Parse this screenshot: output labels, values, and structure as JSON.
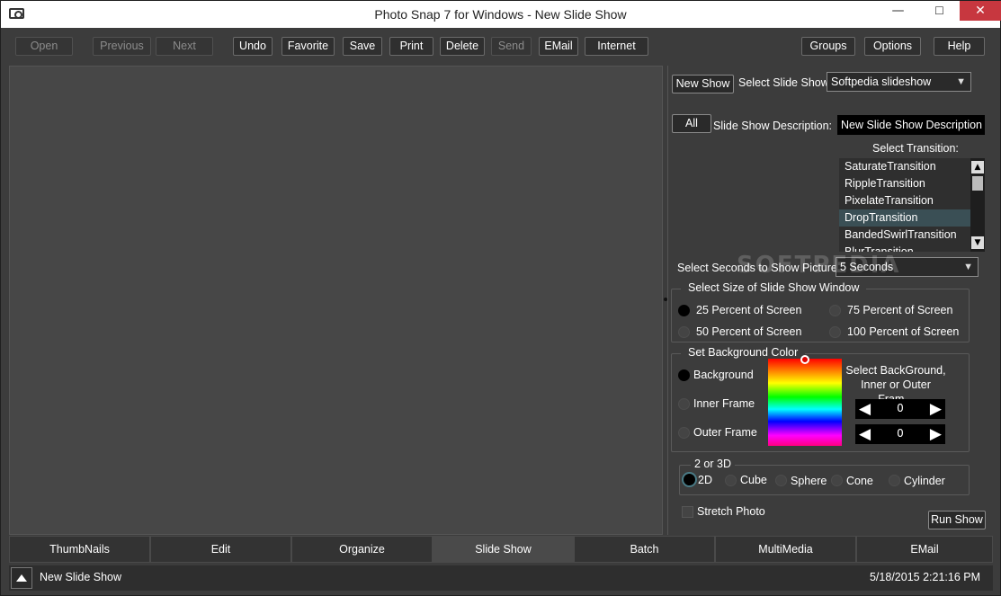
{
  "window": {
    "title": "Photo Snap 7 for Windows - New Slide Show",
    "minimize": "—",
    "maximize": "☐",
    "close": "✕"
  },
  "toolbar": {
    "open": "Open",
    "previous": "Previous",
    "next": "Next",
    "undo": "Undo",
    "favorite": "Favorite",
    "save": "Save",
    "print": "Print",
    "delete": "Delete",
    "send": "Send",
    "email": "EMail",
    "internet": "Internet",
    "groups": "Groups",
    "options": "Options",
    "help": "Help"
  },
  "slideshow": {
    "new_show": "New Show",
    "select_label": "Select Slide Show:",
    "selected_show": "Softpedia slideshow",
    "all": "All",
    "desc_label": "Slide Show Description:",
    "desc_value": "New Slide Show Description",
    "transition_label": "Select Transition:",
    "transitions": [
      "SaturateTransition",
      "RippleTransition",
      "PixelateTransition",
      "DropTransition",
      "BandedSwirlTransition",
      "BlurTransition"
    ],
    "selected_transition": "DropTransition",
    "seconds_label": "Select Seconds to Show Picture:",
    "seconds_value": "5 Seconds",
    "size_group": "Select Size of Slide Show Window",
    "sizes": [
      "25 Percent of Screen",
      "75 Percent of Screen",
      "50 Percent of Screen",
      "100 Percent of Screen"
    ],
    "selected_size": "25 Percent of Screen",
    "bg_group": "Set Background Color",
    "bg_options": [
      "Background",
      "Inner Frame",
      "Outer Frame"
    ],
    "selected_bg": "Background",
    "bg_hint": "Select BackGround, Inner or Outer Fram...",
    "spin1": "0",
    "spin2": "0",
    "dim_group": "2 or 3D",
    "dims": [
      "2D",
      "Cube",
      "Sphere",
      "Cone",
      "Cylinder"
    ],
    "selected_dim": "2D",
    "stretch": "Stretch Photo",
    "run_show": "Run Show"
  },
  "tabs": [
    "ThumbNails",
    "Edit",
    "Organize",
    "Slide Show",
    "Batch",
    "MultiMedia",
    "EMail"
  ],
  "active_tab": "Slide Show",
  "status": {
    "text": "New Slide Show",
    "datetime": "5/18/2015 2:21:16 PM"
  },
  "watermark": "SOFTPEDIA"
}
